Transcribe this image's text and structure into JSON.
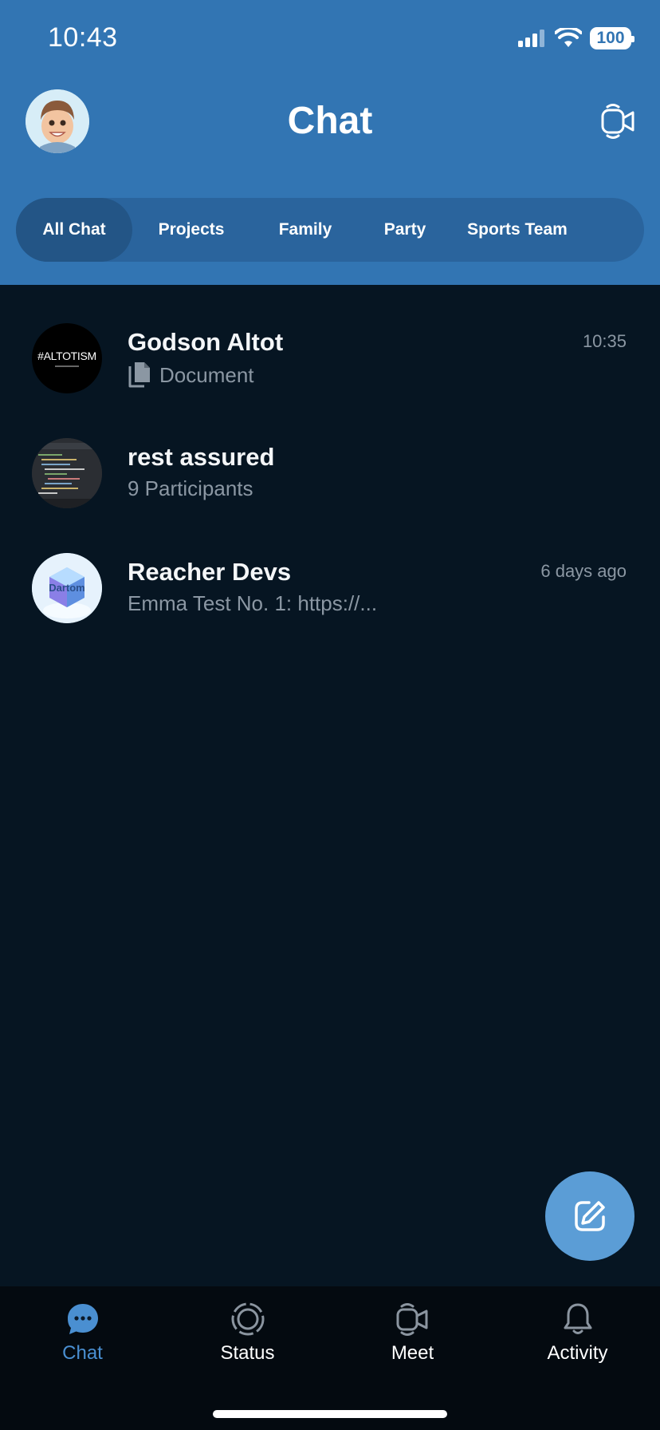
{
  "status_bar": {
    "time": "10:43",
    "battery": "100"
  },
  "header": {
    "title": "Chat"
  },
  "tabs": [
    {
      "label": "All Chat",
      "active": true
    },
    {
      "label": "Projects",
      "active": false
    },
    {
      "label": "Family",
      "active": false
    },
    {
      "label": "Party",
      "active": false
    },
    {
      "label": "Sports Team",
      "active": false
    }
  ],
  "chats": [
    {
      "name": "Godson Altot",
      "preview": "Document",
      "time": "10:35",
      "avatar_text": "#ALTOTISM",
      "preview_icon": "document-icon"
    },
    {
      "name": "rest assured",
      "preview": "9 Participants",
      "time": ""
    },
    {
      "name": "Reacher Devs",
      "preview": "Emma Test No. 1:  https://...",
      "time": "6 days ago",
      "avatar_text": "Dartom"
    }
  ],
  "nav": [
    {
      "label": "Chat",
      "icon": "chat-bubble-icon",
      "active": true
    },
    {
      "label": "Status",
      "icon": "status-ring-icon",
      "active": false
    },
    {
      "label": "Meet",
      "icon": "video-camera-icon",
      "active": false
    },
    {
      "label": "Activity",
      "icon": "bell-icon",
      "active": false
    }
  ],
  "colors": {
    "header_bg": "#3275b3",
    "body_bg": "#061522",
    "accent": "#4a8fd1",
    "fab": "#5b9dd6"
  }
}
